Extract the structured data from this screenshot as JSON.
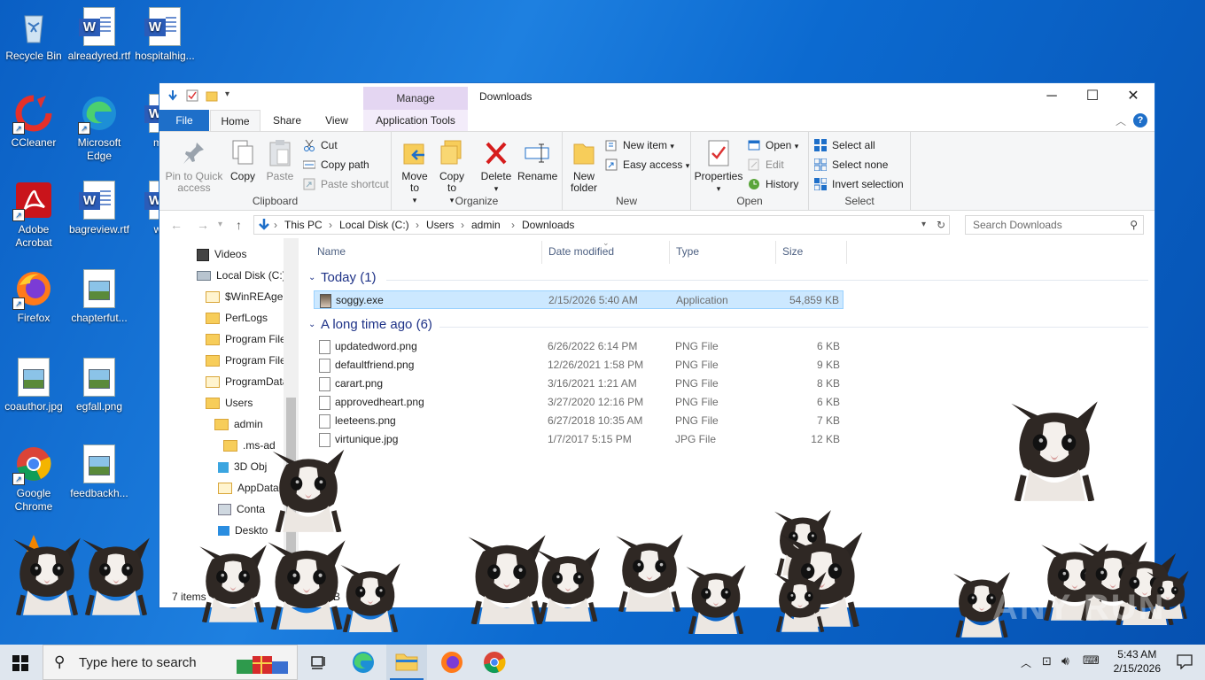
{
  "desktop": {
    "icons": [
      {
        "label": "Recycle Bin",
        "icon": "recycle-bin-icon"
      },
      {
        "label": "alreadyred.rtf",
        "icon": "word-document-icon"
      },
      {
        "label": "hospitalhig...",
        "icon": "word-document-icon"
      },
      {
        "label": "CCleaner",
        "icon": "ccleaner-icon"
      },
      {
        "label": "Microsoft Edge",
        "icon": "edge-icon"
      },
      {
        "label": "male",
        "icon": "word-document-icon"
      },
      {
        "label": "Adobe Acrobat",
        "icon": "acrobat-icon"
      },
      {
        "label": "bagreview.rtf",
        "icon": "word-document-icon"
      },
      {
        "label": "wine",
        "icon": "word-document-icon"
      },
      {
        "label": "Firefox",
        "icon": "firefox-icon"
      },
      {
        "label": "chapterfut...",
        "icon": "image-file-icon"
      },
      {
        "label": "coauthor.jpg",
        "icon": "image-file-icon"
      },
      {
        "label": "egfall.png",
        "icon": "image-file-icon"
      },
      {
        "label": "Google Chrome",
        "icon": "chrome-icon"
      },
      {
        "label": "feedbackh...",
        "icon": "image-file-icon"
      },
      {
        "label": "VLC",
        "icon": "vlc-icon"
      }
    ]
  },
  "window": {
    "title": "Downloads",
    "manage_tab": "Manage",
    "tabs": {
      "file": "File",
      "home": "Home",
      "share": "Share",
      "view": "View",
      "app_tools": "Application Tools"
    },
    "ribbon": {
      "clipboard": {
        "pin_quick_access": "Pin to Quick access",
        "copy": "Copy",
        "paste": "Paste",
        "cut": "Cut",
        "copy_path": "Copy path",
        "paste_shortcut": "Paste shortcut",
        "group_label": "Clipboard"
      },
      "organize": {
        "move_to": "Move to",
        "copy_to": "Copy to",
        "delete": "Delete",
        "rename": "Rename",
        "group_label": "Organize"
      },
      "new": {
        "new_folder": "New folder",
        "new_item": "New item",
        "easy_access": "Easy access",
        "group_label": "New"
      },
      "open": {
        "properties": "Properties",
        "open": "Open",
        "edit": "Edit",
        "history": "History",
        "group_label": "Open"
      },
      "select": {
        "select_all": "Select all",
        "select_none": "Select none",
        "invert_selection": "Invert selection",
        "group_label": "Select"
      }
    },
    "address": {
      "crumbs": [
        "This PC",
        "Local Disk (C:)",
        "Users",
        "admin",
        "Downloads"
      ],
      "search_placeholder": "Search Downloads"
    },
    "nav": [
      {
        "label": "Videos"
      },
      {
        "label": "Local Disk (C:)"
      },
      {
        "label": "$WinREAgent"
      },
      {
        "label": "PerfLogs"
      },
      {
        "label": "Program Files"
      },
      {
        "label": "Program Files"
      },
      {
        "label": "ProgramData"
      },
      {
        "label": "Users"
      },
      {
        "label": "admin"
      },
      {
        "label": ".ms-ad"
      },
      {
        "label": "3D Obj"
      },
      {
        "label": "AppData"
      },
      {
        "label": "Conta"
      },
      {
        "label": "Deskto"
      }
    ],
    "columns": {
      "name": "Name",
      "date": "Date modified",
      "type": "Type",
      "size": "Size"
    },
    "groups": {
      "today": "Today (1)",
      "long_ago": "A long time ago (6)"
    },
    "files_today": [
      {
        "name": "soggy.exe",
        "date": "2/15/2026 5:40 AM",
        "type": "Application",
        "size": "54,859 KB"
      }
    ],
    "files_old": [
      {
        "name": "updatedword.png",
        "date": "6/26/2022 6:14 PM",
        "type": "PNG File",
        "size": "6 KB"
      },
      {
        "name": "defaultfriend.png",
        "date": "12/26/2021 1:58 PM",
        "type": "PNG File",
        "size": "9 KB"
      },
      {
        "name": "carart.png",
        "date": "3/16/2021 1:21 AM",
        "type": "PNG File",
        "size": "8 KB"
      },
      {
        "name": "approvedheart.png",
        "date": "3/27/2020 12:16 PM",
        "type": "PNG File",
        "size": "6 KB"
      },
      {
        "name": "leeteens.png",
        "date": "6/27/2018 10:35 AM",
        "type": "PNG File",
        "size": "7 KB"
      },
      {
        "name": "virtunique.jpg",
        "date": "1/7/2017 5:15 PM",
        "type": "JPG File",
        "size": "12 KB"
      }
    ],
    "status": {
      "count": "7 items",
      "extra": "MB"
    }
  },
  "taskbar": {
    "search_placeholder": "Type here to search",
    "time": "5:43 AM",
    "date": "2/15/2026"
  },
  "watermark": "ANY RUN"
}
